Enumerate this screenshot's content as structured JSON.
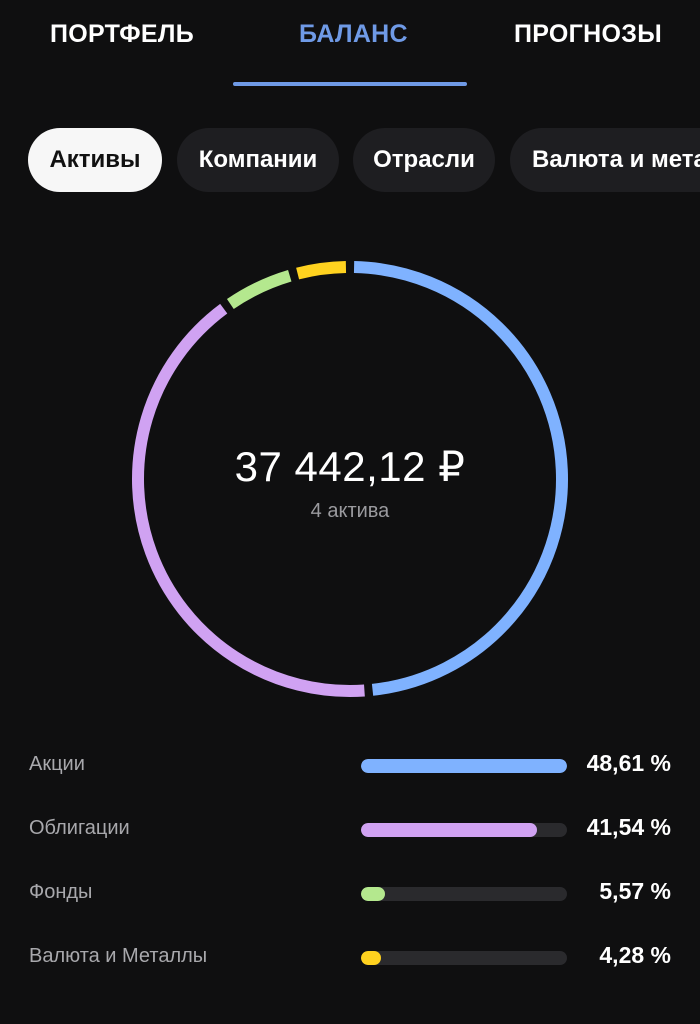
{
  "tabs": {
    "portfolio": "ПОРТФЕЛЬ",
    "balance": "БАЛАНС",
    "forecast": "ПРОГНОЗЫ",
    "active": "balance"
  },
  "chips": {
    "assets": "Активы",
    "companies": "Компании",
    "sectors": "Отрасли",
    "currency": "Валюта и металлы",
    "active": "assets"
  },
  "summary": {
    "total": "37 442,12 ₽",
    "count": "4 актива"
  },
  "colors": {
    "accent": "#6f9ae6",
    "stocks": "#7fb2ff",
    "bonds": "#d0a2f2",
    "funds": "#b4e88e",
    "currency": "#ffd21f"
  },
  "chart_data": {
    "type": "pie",
    "categories": [
      "Акции",
      "Облигации",
      "Фонды",
      "Валюта и Металлы"
    ],
    "values": [
      48.61,
      41.54,
      5.57,
      4.28
    ],
    "value_labels": [
      "48,61 %",
      "41,54 %",
      "5,57 %",
      "4,28 %"
    ],
    "colors": [
      "#7fb2ff",
      "#d0a2f2",
      "#b4e88e",
      "#ffd21f"
    ]
  }
}
